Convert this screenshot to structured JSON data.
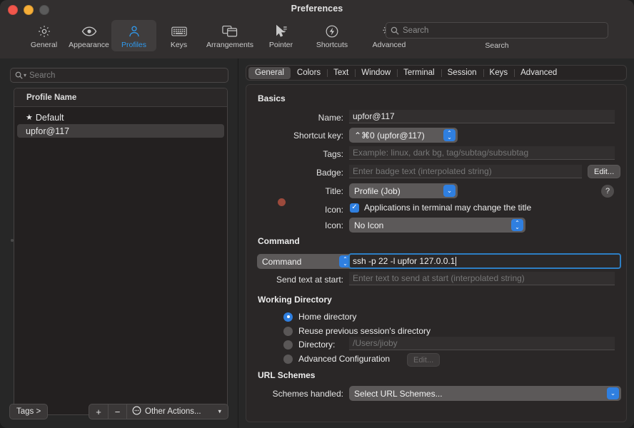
{
  "window": {
    "title": "Preferences",
    "traffic_lights": [
      "close",
      "minimize",
      "zoom"
    ]
  },
  "toolbar": {
    "items": [
      {
        "label": "General",
        "icon": "gear-icon",
        "active": false
      },
      {
        "label": "Appearance",
        "icon": "eye-icon",
        "active": false
      },
      {
        "label": "Profiles",
        "icon": "person-icon",
        "active": true
      },
      {
        "label": "Keys",
        "icon": "keyboard-icon",
        "active": false
      },
      {
        "label": "Arrangements",
        "icon": "windows-icon",
        "active": false
      },
      {
        "label": "Pointer",
        "icon": "cursor-icon",
        "active": false
      },
      {
        "label": "Shortcuts",
        "icon": "bolt-circle-icon",
        "active": false
      },
      {
        "label": "Advanced",
        "icon": "double-gear-icon",
        "active": false
      }
    ],
    "search": {
      "placeholder": "Search",
      "caption": "Search",
      "icon": "search-icon",
      "value": ""
    },
    "accent_color": "#2f9bf0"
  },
  "sidebar": {
    "search": {
      "placeholder": "Search",
      "value": "",
      "icon": "search-icon"
    },
    "list": {
      "header": "Profile Name",
      "rows": [
        {
          "name": "Default",
          "starred": true,
          "selected": false
        },
        {
          "name": "upfor@117",
          "starred": false,
          "selected": true
        }
      ]
    },
    "bottom": {
      "tags_button": "Tags >",
      "add_button": "+",
      "remove_button": "−",
      "other_actions": "Other Actions...",
      "other_actions_icon": "ellipsis-circle-icon",
      "chevron": "⌄"
    }
  },
  "pane": {
    "tabs": [
      {
        "label": "General",
        "active": true
      },
      {
        "label": "Colors",
        "active": false
      },
      {
        "label": "Text",
        "active": false
      },
      {
        "label": "Window",
        "active": false
      },
      {
        "label": "Terminal",
        "active": false
      },
      {
        "label": "Session",
        "active": false
      },
      {
        "label": "Keys",
        "active": false
      },
      {
        "label": "Advanced",
        "active": false
      }
    ],
    "sections": {
      "basics": {
        "title": "Basics",
        "name_label": "Name:",
        "name_value": "upfor@117",
        "shortcut_label": "Shortcut key:",
        "shortcut_value": "⌃⌘0 (upfor@117)",
        "tags_label": "Tags:",
        "tags_placeholder": "Example: linux, dark bg, tag/subtag/subsubtag",
        "tags_value": "",
        "badge_label": "Badge:",
        "badge_placeholder": "Enter badge text (interpolated string)",
        "badge_value": "",
        "badge_edit_button": "Edit...",
        "title_label": "Title:",
        "title_value": "Profile (Job)",
        "help_button": "?",
        "apps_change_title_label": "Applications in terminal may change the title",
        "apps_change_title_checked": true,
        "icon_label": "Icon:",
        "icon_value": "No Icon"
      },
      "command": {
        "title": "Command",
        "type_value": "Command",
        "command_value": "ssh -p 22 -l upfor 127.0.0.1",
        "send_text_label": "Send text at start:",
        "send_text_placeholder": "Enter text to send at start (interpolated string)",
        "send_text_value": ""
      },
      "working_directory": {
        "title": "Working Directory",
        "options": [
          {
            "label": "Home directory",
            "selected": true
          },
          {
            "label": "Reuse previous session's directory",
            "selected": false
          },
          {
            "label": "Directory:",
            "selected": false
          },
          {
            "label": "Advanced Configuration",
            "selected": false
          }
        ],
        "directory_placeholder": "/Users/jioby",
        "directory_value": "",
        "advanced_edit_button": "Edit..."
      },
      "url_schemes": {
        "title": "URL Schemes",
        "schemes_label": "Schemes handled:",
        "schemes_value": "Select URL Schemes..."
      }
    }
  }
}
